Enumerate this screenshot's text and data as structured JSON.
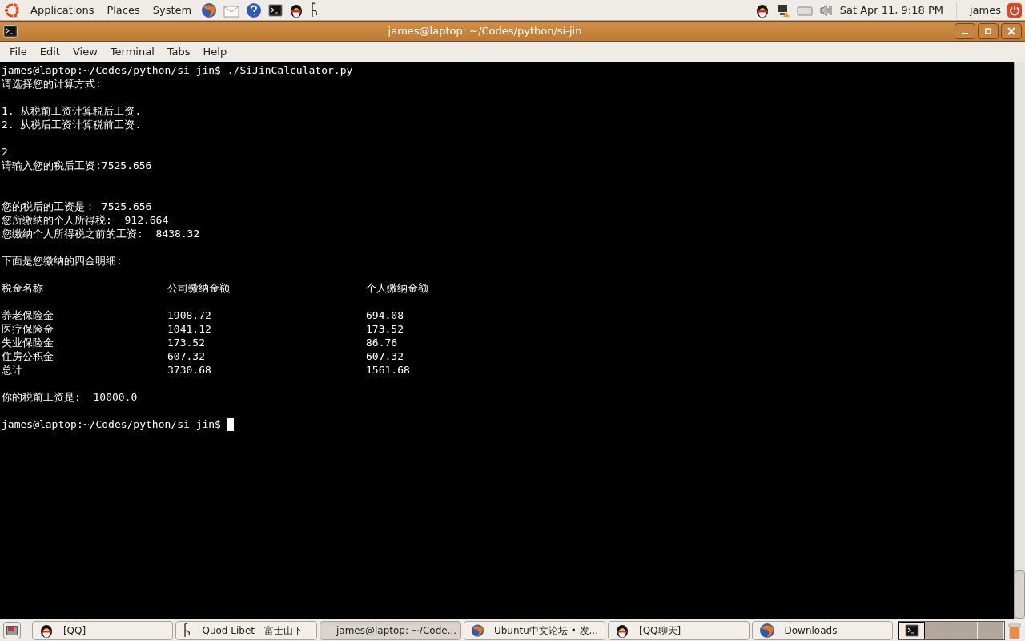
{
  "top_panel": {
    "menus": [
      "Applications",
      "Places",
      "System"
    ],
    "clock": "Sat Apr 11,  9:18 PM",
    "user": "james"
  },
  "window": {
    "title": "james@laptop: ~/Codes/python/si-jin",
    "menu": [
      "File",
      "Edit",
      "View",
      "Terminal",
      "Tabs",
      "Help"
    ]
  },
  "terminal": {
    "lines": [
      {
        "kind": "text",
        "text": "james@laptop:~/Codes/python/si-jin$ ./SiJinCalculator.py"
      },
      {
        "kind": "text",
        "text": "请选择您的计算方式:"
      },
      {
        "kind": "blank"
      },
      {
        "kind": "text",
        "text": "1. 从税前工资计算税后工资."
      },
      {
        "kind": "text",
        "text": "2. 从税后工资计算税前工资."
      },
      {
        "kind": "blank"
      },
      {
        "kind": "text",
        "text": "2"
      },
      {
        "kind": "text",
        "text": "请输入您的税后工资:7525.656"
      },
      {
        "kind": "blank"
      },
      {
        "kind": "blank"
      },
      {
        "kind": "text",
        "text": "您的税后的工资是： 7525.656"
      },
      {
        "kind": "text",
        "text": "您所缴纳的个人所得税:  912.664"
      },
      {
        "kind": "text",
        "text": "您缴纳个人所得税之前的工资:  8438.32"
      },
      {
        "kind": "blank"
      },
      {
        "kind": "text",
        "text": "下面是您缴纳的四金明细:"
      },
      {
        "kind": "blank"
      },
      {
        "kind": "row",
        "cells": [
          "税金名称",
          "公司缴纳金额",
          "个人缴纳金额"
        ]
      },
      {
        "kind": "blank"
      },
      {
        "kind": "row",
        "cells": [
          "养老保险金",
          "1908.72",
          "694.08"
        ]
      },
      {
        "kind": "row",
        "cells": [
          "医疗保险金",
          "1041.12",
          "173.52"
        ]
      },
      {
        "kind": "row",
        "cells": [
          "失业保险金",
          "173.52",
          "86.76"
        ]
      },
      {
        "kind": "row",
        "cells": [
          "住房公积金",
          "607.32",
          "607.32"
        ]
      },
      {
        "kind": "row",
        "cells": [
          "总计",
          "3730.68",
          "1561.68"
        ]
      },
      {
        "kind": "blank"
      },
      {
        "kind": "text",
        "text": "你的税前工资是:  10000.0"
      },
      {
        "kind": "blank"
      },
      {
        "kind": "prompt",
        "text": "james@laptop:~/Codes/python/si-jin$ ",
        "cursor": true
      }
    ]
  },
  "taskbar": {
    "tasks": [
      {
        "label": "[QQ]",
        "kind": "chat",
        "selected": false
      },
      {
        "label": "Quod Libet - 富士山下",
        "kind": "player",
        "selected": false
      },
      {
        "label": "james@laptop: ~/Code...",
        "kind": "terminal",
        "selected": true
      },
      {
        "label": "Ubuntu中文论坛 • 发...",
        "kind": "browser",
        "selected": false
      },
      {
        "label": "[QQ聊天]",
        "kind": "chat",
        "selected": false
      },
      {
        "label": "Downloads",
        "kind": "browser",
        "selected": false
      }
    ],
    "workspaces": [
      {
        "selected": true
      },
      {
        "selected": false
      },
      {
        "selected": false
      },
      {
        "selected": false
      }
    ]
  }
}
